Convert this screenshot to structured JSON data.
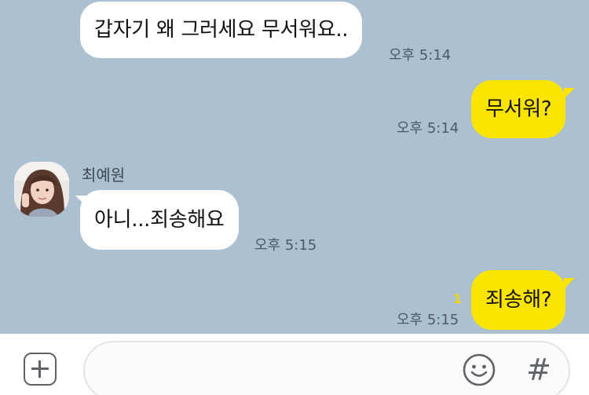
{
  "chat": {
    "messages": [
      {
        "direction": "incoming",
        "text": "갑자기 왜 그러세요 무서워요..",
        "time": "오후 5:14"
      },
      {
        "direction": "outgoing",
        "text": "무서워?",
        "time": "오후 5:14"
      },
      {
        "direction": "incoming",
        "sender": "최예원",
        "avatar_icon": "profile-photo",
        "text": "아니...죄송해요",
        "time": "오후 5:15"
      },
      {
        "direction": "outgoing",
        "text": "죄송해?",
        "time": "오후 5:15",
        "unread_count": "1"
      }
    ]
  },
  "input_bar": {
    "plus_icon": "plus-square-icon",
    "message_value": "",
    "emoji_icon": "smiley-icon",
    "hash_label": "#"
  },
  "colors": {
    "chat_background": "#abc1d1",
    "incoming_bubble": "#ffffff",
    "outgoing_bubble": "#fbe400",
    "timestamp": "#4d5a66",
    "unread": "#f4d400"
  }
}
